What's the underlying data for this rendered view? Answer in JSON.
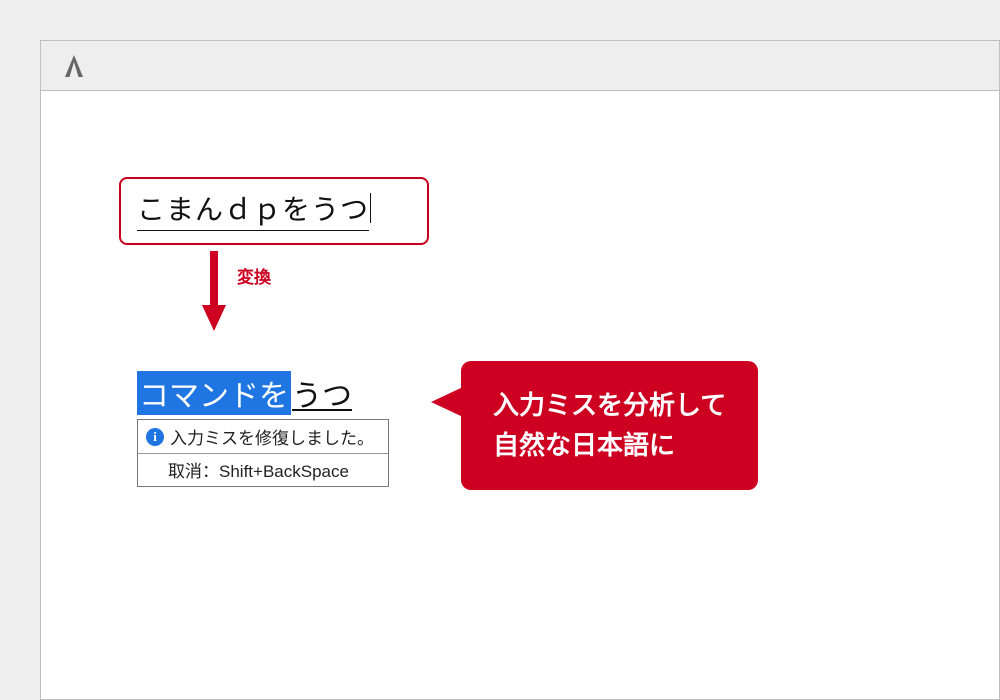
{
  "input_before": "こまんｄｐをうつ",
  "arrow_label": "変換",
  "candidate": {
    "selected": "コマンドを",
    "rest": "うつ"
  },
  "ime_tooltip": {
    "message": "入力ミスを修復しました。",
    "undo_hint": "取消：Shift+BackSpace"
  },
  "callout": {
    "line1": "入力ミスを分析して",
    "line2": "自然な日本語に"
  }
}
